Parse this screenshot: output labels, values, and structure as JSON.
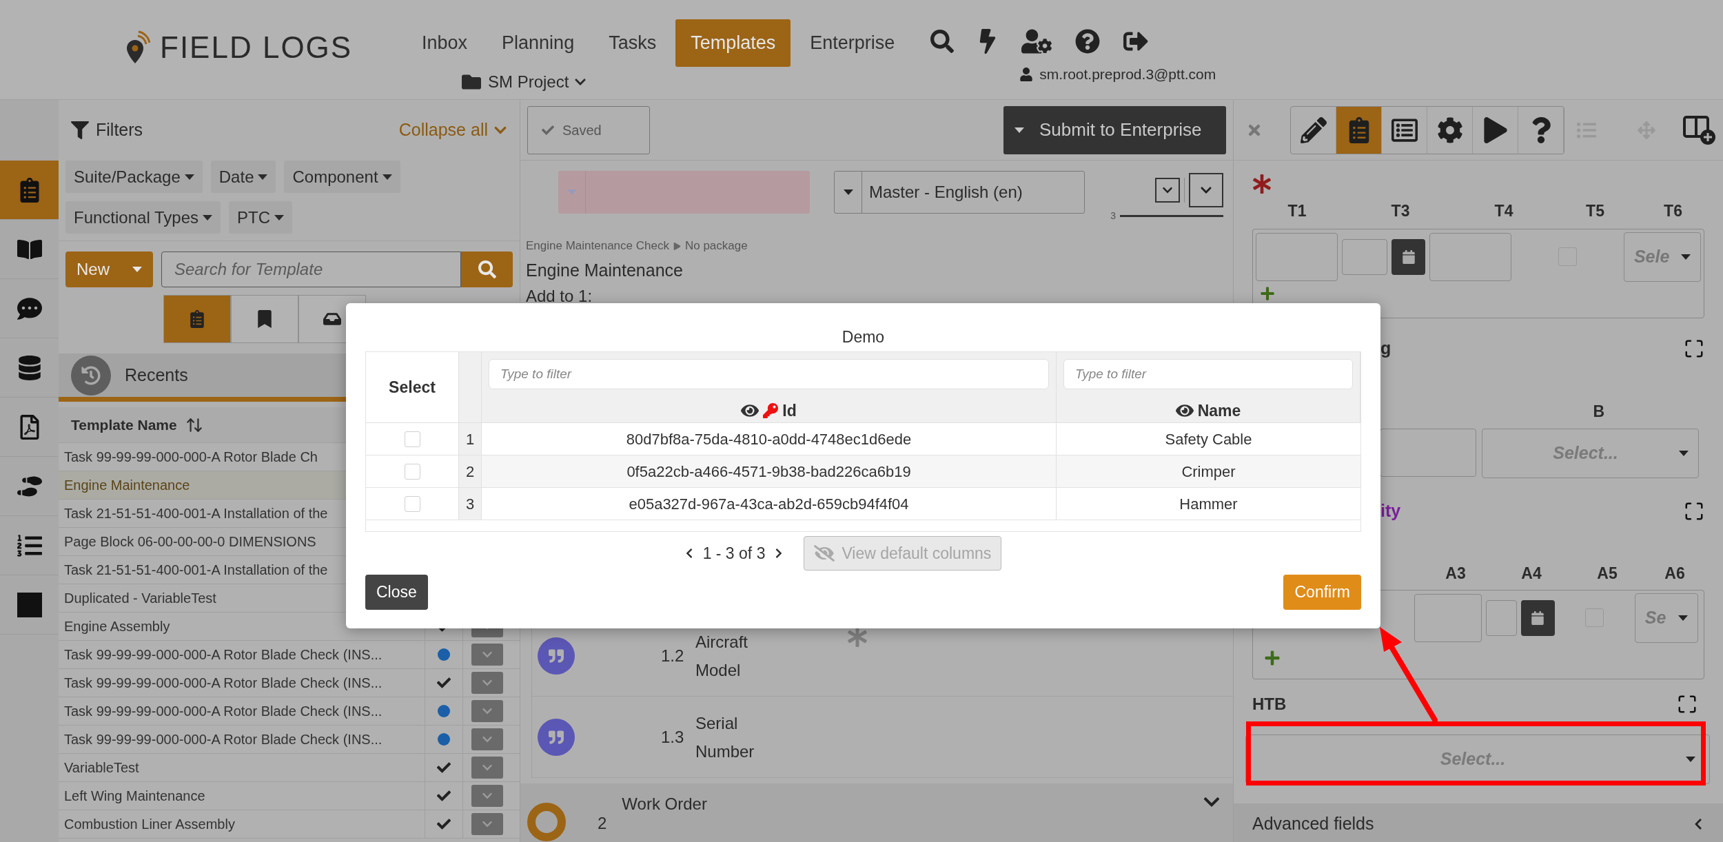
{
  "header": {
    "logo": "FIELD LOGS",
    "nav": [
      {
        "label": "Inbox",
        "selected": false
      },
      {
        "label": "Planning",
        "selected": false
      },
      {
        "label": "Tasks",
        "selected": false
      },
      {
        "label": "Templates",
        "selected": true
      },
      {
        "label": "Enterprise",
        "selected": false
      }
    ],
    "project": "SM Project",
    "user": "sm.root.preprod.3@ptt.com"
  },
  "rail": [
    {
      "kind": "clipboard",
      "selected": true
    },
    {
      "kind": "book",
      "selected": false
    },
    {
      "kind": "chat",
      "selected": false
    },
    {
      "kind": "database",
      "selected": false
    },
    {
      "kind": "pdf",
      "selected": false
    },
    {
      "kind": "footprints",
      "selected": false
    },
    {
      "kind": "numbered-list",
      "selected": false
    },
    {
      "kind": "square",
      "selected": false
    }
  ],
  "filters": {
    "title": "Filters",
    "collapse": "Collapse all",
    "chips": [
      "Suite/Package",
      "Date",
      "Component",
      "Functional Types",
      "PTC"
    ]
  },
  "templates_toolbar": {
    "new": "New",
    "search_placeholder": "Search for Template",
    "views": [
      {
        "kind": "clipboard",
        "selected": true
      },
      {
        "kind": "bookmark",
        "selected": false
      },
      {
        "kind": "inbox",
        "selected": false
      }
    ]
  },
  "recents": "Recents",
  "template_table": {
    "column": "Template Name",
    "rows": [
      {
        "name": "Task 99-99-99-000-000-A Rotor Blade Ch",
        "selected": false
      },
      {
        "name": "Engine Maintenance",
        "selected": true
      },
      {
        "name": "Task 21-51-51-400-001-A Installation of the",
        "selected": false
      },
      {
        "name": "Page Block 06-00-00-00-0 DIMENSIONS",
        "selected": false
      },
      {
        "name": "Task 21-51-51-400-001-A Installation of the",
        "selected": false
      },
      {
        "name": "Duplicated - VariableTest",
        "selected": false
      },
      {
        "name": "Engine Assembly",
        "selected": false,
        "kind": "check"
      },
      {
        "name": "Task 99-99-99-000-000-A Rotor Blade Check (INS...",
        "selected": false,
        "kind": "dot"
      },
      {
        "name": "Task 99-99-99-000-000-A Rotor Blade Check (INS...",
        "selected": false,
        "kind": "check"
      },
      {
        "name": "Task 99-99-99-000-000-A Rotor Blade Check (INS...",
        "selected": false,
        "kind": "dot"
      },
      {
        "name": "Task 99-99-99-000-000-A Rotor Blade Check (INS...",
        "selected": false,
        "kind": "dot"
      },
      {
        "name": "VariableTest",
        "selected": false,
        "kind": "check"
      },
      {
        "name": "Left Wing Maintenance",
        "selected": false,
        "kind": "check"
      },
      {
        "name": "Combustion Liner Assembly",
        "selected": false,
        "kind": "check"
      }
    ]
  },
  "editor": {
    "saved": "Saved",
    "submit": "Submit to Enterprise",
    "language": "Master - English (en)",
    "counter": "3",
    "breadcrumb": [
      "Engine Maintenance Check",
      "No package"
    ],
    "title": "Engine Maintenance",
    "add_to": "Add to 1:",
    "items": [
      {
        "number": "1.2",
        "label": "Aircraft Model",
        "required": true
      },
      {
        "number": "1.3",
        "label": "Serial Number",
        "required": false
      }
    ],
    "section": {
      "number": "2",
      "label": "Work Order"
    }
  },
  "inspector": {
    "tools": [
      {
        "kind": "pencil",
        "selected": false
      },
      {
        "kind": "clipboard",
        "selected": true
      },
      {
        "kind": "form",
        "selected": false
      },
      {
        "kind": "settings",
        "selected": false
      },
      {
        "kind": "play",
        "selected": false
      },
      {
        "kind": "help",
        "selected": false
      }
    ],
    "table1": {
      "columns": [
        "T1",
        "T3",
        "T4",
        "T5",
        "T6"
      ],
      "checked": false,
      "select_placeholder": "Sele"
    },
    "heading1": "g",
    "b_column": "B",
    "b_placeholder": "Select...",
    "heading2": "ity",
    "table2": {
      "columns": [
        "A3",
        "A4",
        "A5",
        "A6"
      ],
      "checked": false,
      "select_placeholder": "Se"
    },
    "htb": {
      "label": "HTB",
      "placeholder": "Select..."
    },
    "advanced": "Advanced fields"
  },
  "dialog": {
    "title": "Demo",
    "select_header": "Select",
    "columns": [
      {
        "label": "Id",
        "key": true,
        "filter_placeholder": "Type to filter"
      },
      {
        "label": "Name",
        "key": false,
        "filter_placeholder": "Type to filter"
      }
    ],
    "rows": [
      {
        "index": "1",
        "id": "80d7bf8a-75da-4810-a0dd-4748ec1d6ede",
        "name": "Safety Cable",
        "checked": false
      },
      {
        "index": "2",
        "id": "0f5a22cb-a466-4571-9b38-bad226ca6b19",
        "name": "Crimper",
        "checked": false
      },
      {
        "index": "3",
        "id": "e05a327d-967a-43ca-ab2d-659cb94f4f04",
        "name": "Hammer",
        "checked": false
      }
    ],
    "pagination": "1 - 3 of 3",
    "view_default": "View default columns",
    "close": "Close",
    "confirm": "Confirm"
  }
}
